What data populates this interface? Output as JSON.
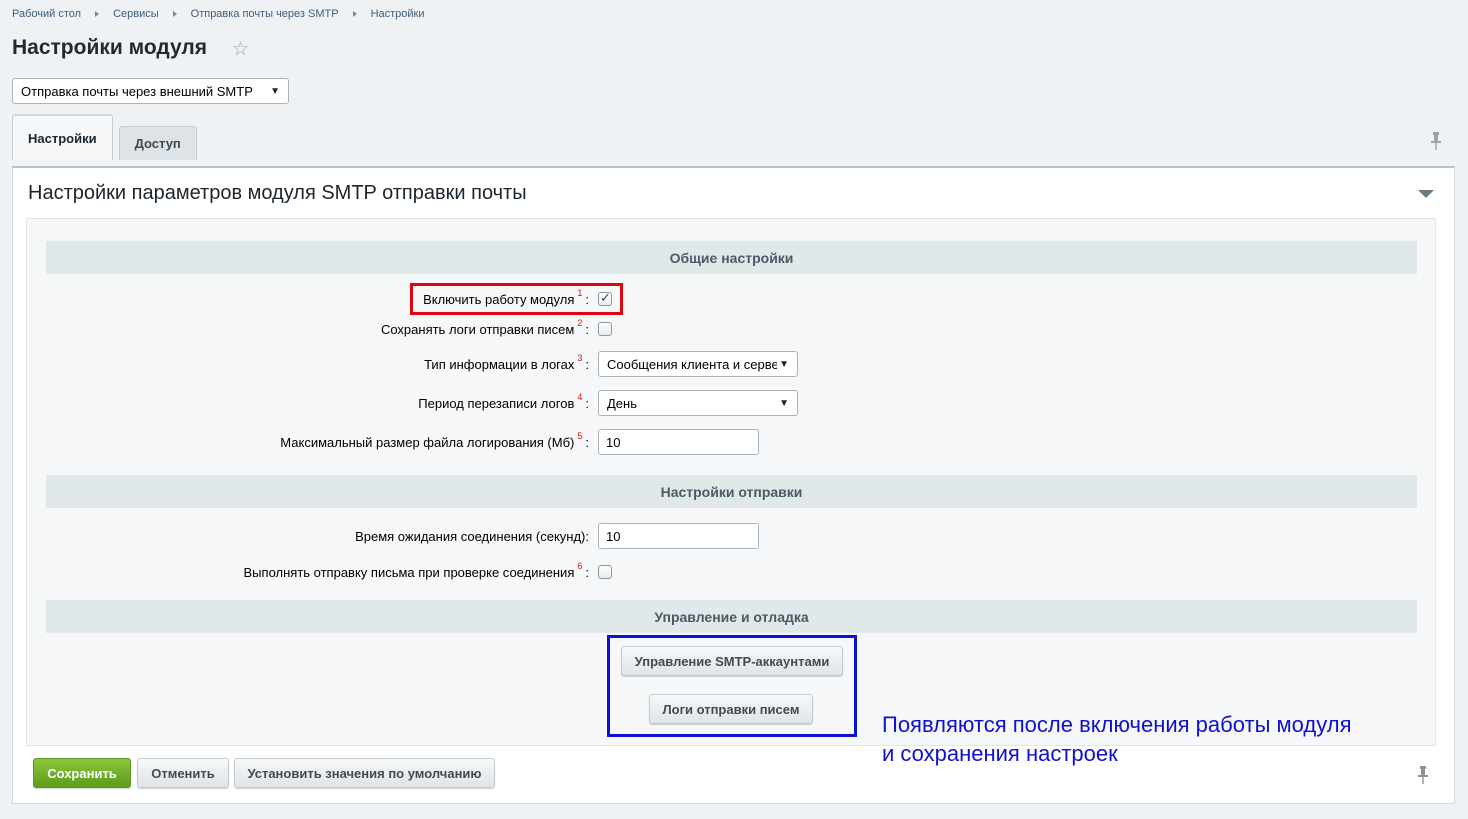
{
  "breadcrumb": [
    "Рабочий стол",
    "Сервисы",
    "Отправка почты через SMTP",
    "Настройки"
  ],
  "page_title": "Настройки модуля",
  "module_select": {
    "value": "Отправка почты через внешний SMTP"
  },
  "tabs": [
    {
      "label": "Настройки",
      "active": true
    },
    {
      "label": "Доступ",
      "active": false
    }
  ],
  "section_title": "Настройки параметров модуля SMTP отправки почты",
  "groups": {
    "general": "Общие настройки",
    "sending": "Настройки отправки",
    "management": "Управление и отладка"
  },
  "fields": {
    "enable": {
      "label": "Включить работу модуля",
      "sup": "1",
      "colon": ":",
      "checked": true
    },
    "save_logs": {
      "label": "Сохранять логи отправки писем",
      "sup": "2",
      "colon": ":",
      "checked": false
    },
    "log_type": {
      "label": "Тип информации в логах",
      "sup": "3",
      "colon": ":",
      "value": "Сообщения клиента и сервера"
    },
    "log_period": {
      "label": "Период перезаписи логов",
      "sup": "4",
      "colon": ":",
      "value": "День"
    },
    "log_max_size": {
      "label": "Максимальный размер файла логирования (Мб)",
      "sup": "5",
      "colon": ":",
      "value": "10"
    },
    "timeout": {
      "label": "Время ожидания соединения (секунд):",
      "value": "10"
    },
    "send_on_check": {
      "label": "Выполнять отправку письма при проверке соединения",
      "sup": "6",
      "colon": ":",
      "checked": false
    }
  },
  "buttons": {
    "smtp_accounts": "Управление SMTP-аккаунтами",
    "send_logs": "Логи отправки писем",
    "save": "Сохранить",
    "cancel": "Отменить",
    "defaults": "Установить значения по умолчанию"
  },
  "note": {
    "line1": "Появляются после включения работы модуля",
    "line2": "и сохранения настроек"
  },
  "colors": {
    "highlight_red": "#e2040b",
    "highlight_blue": "#0b12d4",
    "note_text": "#1010d0",
    "save_green": "#6aab24"
  }
}
